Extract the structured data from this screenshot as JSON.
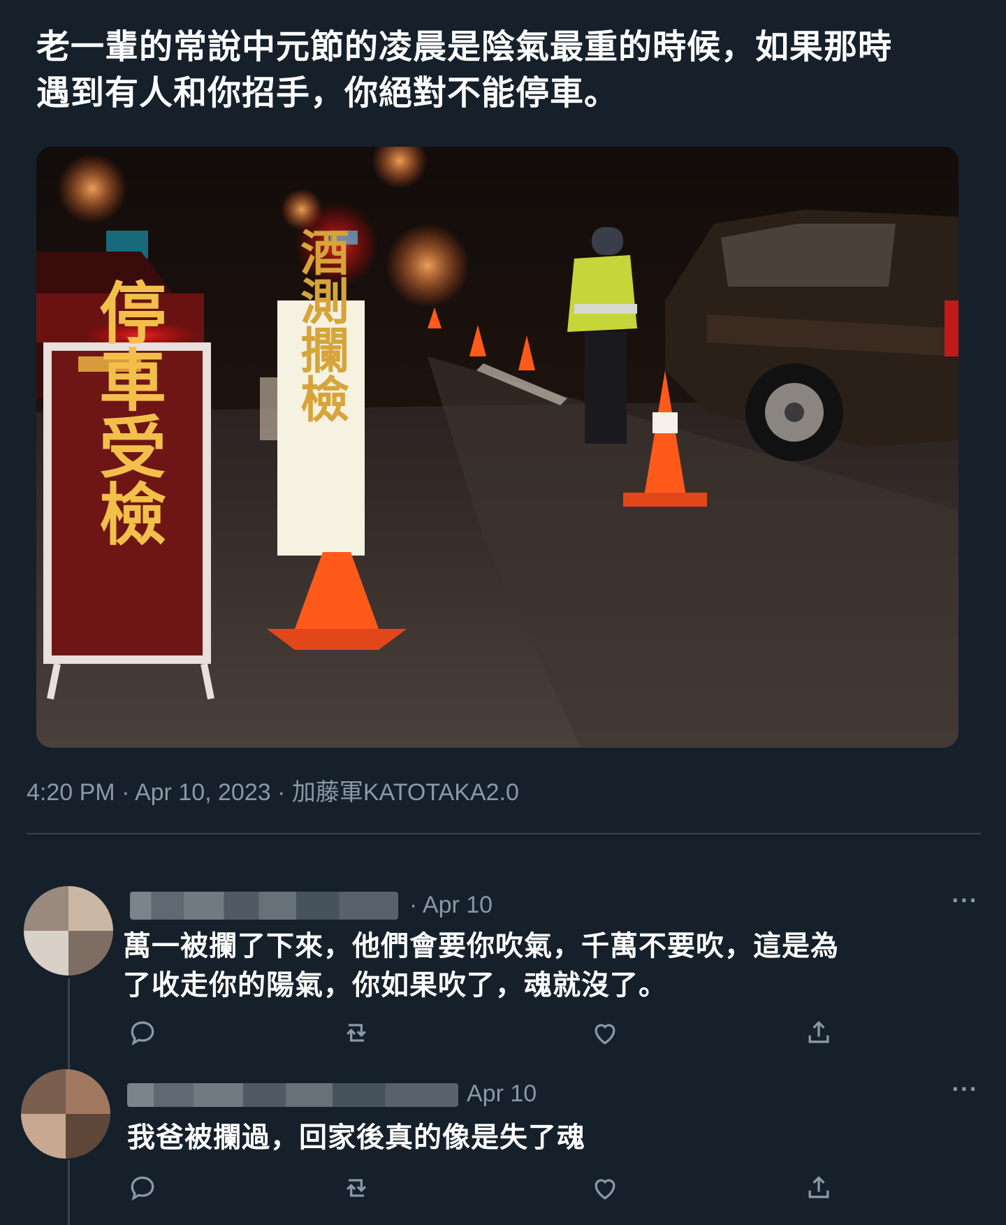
{
  "tweet": {
    "text": "老一輩的常說中元節的凌晨是陰氣最重的時候，如果那時\n遇到有人和你招手，你絕對不能停車。",
    "photo": {
      "sign_left": "停車受檢",
      "sign_right": "酒測攔檢"
    },
    "meta": "4:20 PM · Apr 10, 2023 · 加藤軍KATOTAKA2.0"
  },
  "replies": [
    {
      "date": "· Apr 10",
      "text": "萬一被攔了下來，他們會要你吹氣，千萬不要吹，這是為\n了收走你的陽氣，你如果吹了，魂就沒了。",
      "more": "···"
    },
    {
      "date": "Apr 10",
      "text": "我爸被攔過，回家後真的像是失了魂",
      "more": "···"
    }
  ],
  "actions": [
    "reply-icon",
    "retweet-icon",
    "like-icon",
    "share-icon"
  ]
}
